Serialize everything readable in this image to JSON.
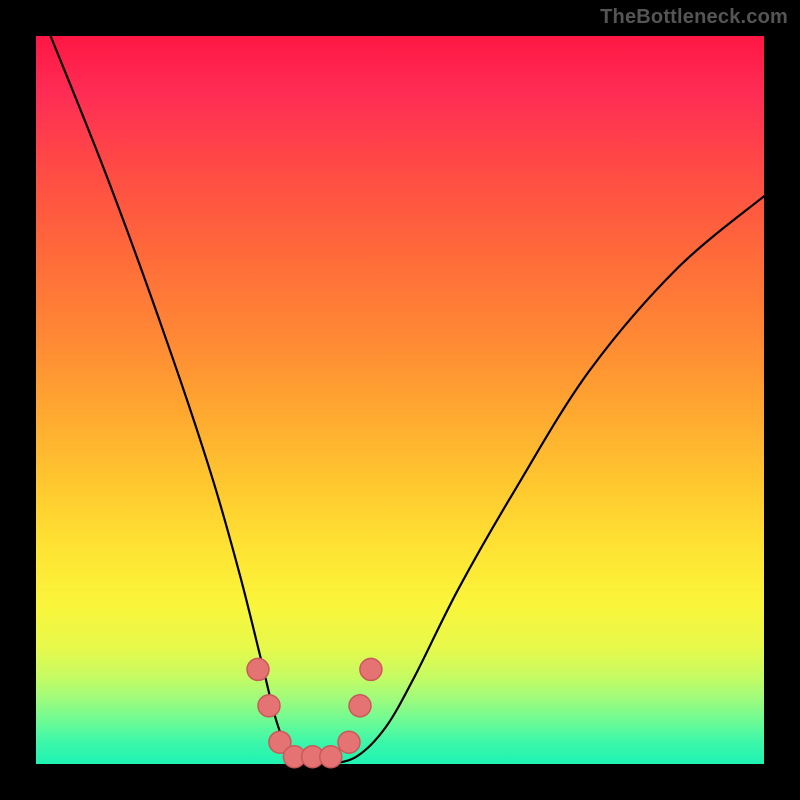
{
  "watermark": "TheBottleneck.com",
  "chart_data": {
    "type": "line",
    "title": "",
    "xlabel": "",
    "ylabel": "",
    "xlim": [
      0,
      100
    ],
    "ylim": [
      0,
      100
    ],
    "grid": false,
    "series": [
      {
        "name": "curve",
        "x": [
          2,
          10,
          18,
          24,
          28,
          31,
          33,
          35,
          37,
          40,
          44,
          48,
          52,
          58,
          66,
          76,
          88,
          100
        ],
        "values": [
          100,
          80,
          58,
          40,
          26,
          14,
          6,
          1,
          0,
          0,
          1,
          5,
          12,
          24,
          38,
          54,
          68,
          78
        ]
      }
    ],
    "markers": {
      "name": "highlighted-points",
      "x": [
        30.5,
        32,
        33.5,
        35.5,
        38,
        40.5,
        43,
        44.5,
        46
      ],
      "values": [
        13,
        8,
        3,
        1,
        1,
        1,
        3,
        8,
        13
      ]
    }
  }
}
